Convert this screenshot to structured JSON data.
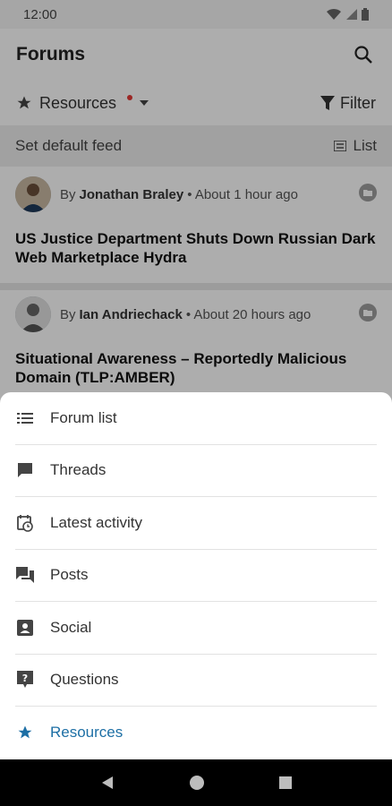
{
  "status_bar": {
    "time": "12:00",
    "icons": [
      "wifi-icon",
      "signal-icon",
      "battery-icon"
    ]
  },
  "app_bar": {
    "title": "Forums",
    "search_icon": "search-icon"
  },
  "toolbar": {
    "resources_label": "Resources",
    "filter_label": "Filter"
  },
  "feed_bar": {
    "set_default_label": "Set default feed",
    "list_label": "List"
  },
  "posts": [
    {
      "by": "By",
      "author": "Jonathan Braley",
      "time": "• About 1 hour ago",
      "title": "US Justice Department Shuts Down Russian Dark Web Marketplace Hydra"
    },
    {
      "by": "By",
      "author": "Ian Andriechack",
      "time": "• About 20 hours ago",
      "title": "Situational Awareness – Reportedly Malicious Domain (TLP:AMBER)"
    }
  ],
  "sheet": {
    "items": [
      {
        "label": "Forum list",
        "icon": "list-icon"
      },
      {
        "label": "Threads",
        "icon": "chat-bubble-icon"
      },
      {
        "label": "Latest activity",
        "icon": "calendar-clock-icon"
      },
      {
        "label": "Posts",
        "icon": "forum-icon"
      },
      {
        "label": "Social",
        "icon": "contact-card-icon"
      },
      {
        "label": "Questions",
        "icon": "question-bubble-icon"
      },
      {
        "label": "Resources",
        "icon": "star-icon",
        "active": true
      }
    ]
  },
  "colors": {
    "accent": "#1d6fa5",
    "notification_dot": "#e53935"
  }
}
